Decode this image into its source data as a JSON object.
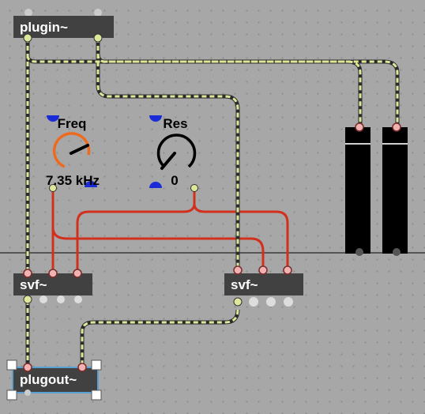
{
  "objects": {
    "plugin": "plugin~",
    "svf_left": "svf~",
    "svf_right": "svf~",
    "plugout": "plugout~"
  },
  "dials": {
    "freq": {
      "title": "Freq",
      "value": "7.35 kHz"
    },
    "res": {
      "title": "Res",
      "value": "0"
    }
  },
  "colors": {
    "signal_cord": "#dfe89a",
    "control_cord": "#d2301e",
    "freq_dial_arc": "#ee6a1e",
    "inlet": "#f2b2b2",
    "outlet": "#dfe89a",
    "selection": "#5aa0d2"
  },
  "icons": [
    "dial",
    "level-meter",
    "inlet",
    "outlet",
    "resize-handle"
  ]
}
